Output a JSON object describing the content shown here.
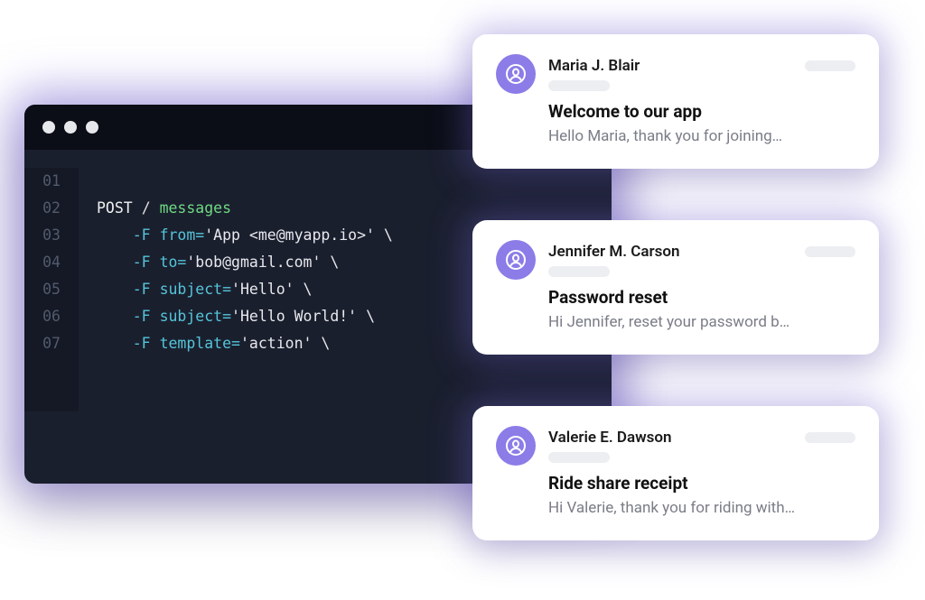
{
  "terminal": {
    "line_numbers": [
      "01",
      "02",
      "03",
      "04",
      "05",
      "06",
      "07"
    ],
    "lines": [
      {
        "method": "POST",
        "slash": "/",
        "endpoint": "messages"
      },
      {
        "flag": "-F",
        "param": "from=",
        "value": "'App <me@myapp.io>'",
        "bs": "\\"
      },
      {
        "flag": "-F",
        "param": "to=",
        "value": "'bob@gmail.com'",
        "bs": "\\"
      },
      {
        "flag": "-F",
        "param": "subject=",
        "value": "'Hello'",
        "bs": "\\"
      },
      {
        "flag": "-F",
        "param": "subject=",
        "value": "'Hello World!'",
        "bs": "\\"
      },
      {
        "flag": "-F",
        "param": "template=",
        "value": "'action'",
        "bs": "\\"
      }
    ]
  },
  "cards": [
    {
      "sender": "Maria J. Blair",
      "subject": "Welcome to our app",
      "preview": "Hello Maria, thank you for joining…"
    },
    {
      "sender": "Jennifer M. Carson",
      "subject": "Password reset",
      "preview": "Hi Jennifer, reset your password b…"
    },
    {
      "sender": "Valerie E. Dawson",
      "subject": "Ride share receipt",
      "preview": "Hi Valerie, thank you for riding with…"
    }
  ]
}
